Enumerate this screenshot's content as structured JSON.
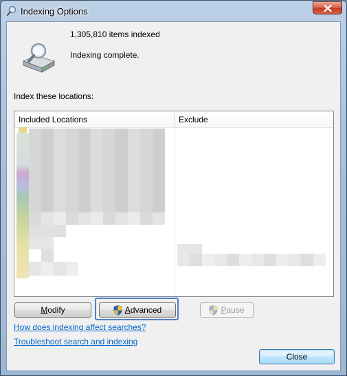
{
  "window": {
    "title": "Indexing Options"
  },
  "status": {
    "items_indexed": "1,305,810 items indexed",
    "state": "Indexing complete."
  },
  "locations": {
    "label": "Index these locations:",
    "columns": [
      "Included Locations",
      "Exclude"
    ]
  },
  "buttons": {
    "modify": {
      "prefix": "",
      "mnemonic": "M",
      "suffix": "odify"
    },
    "advanced": {
      "prefix": "",
      "mnemonic": "A",
      "suffix": "dvanced"
    },
    "pause": {
      "prefix": "",
      "mnemonic": "P",
      "suffix": "ause"
    },
    "close": "Close"
  },
  "links": {
    "how": "How does indexing affect searches?",
    "troubleshoot": "Troubleshoot search and indexing"
  },
  "colors": {
    "link": "#0066cc",
    "highlight": "#4f7ec7"
  }
}
